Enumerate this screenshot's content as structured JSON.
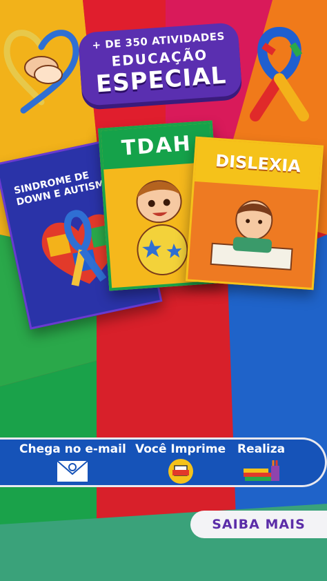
{
  "badge": {
    "line1": "+ DE 350 ATIVIDADES",
    "line2": "EDUCAÇÃO",
    "line3": "ESPECIAL"
  },
  "cards": {
    "down": "SINDROME DE DOWN E AUTISMO",
    "tdah": "TDAH",
    "dislexia": "DISLEXIA"
  },
  "steps": {
    "email": "Chega no e-mail",
    "print": "Você Imprime",
    "do": "Realiza"
  },
  "cta": {
    "label": "SAIBA MAIS"
  },
  "colors": {
    "purple": "#5a2fb0",
    "blue": "#1653b8",
    "red": "#d8202a",
    "yellow": "#f5b81c",
    "green": "#2aa84a",
    "orange": "#f07a1a"
  }
}
